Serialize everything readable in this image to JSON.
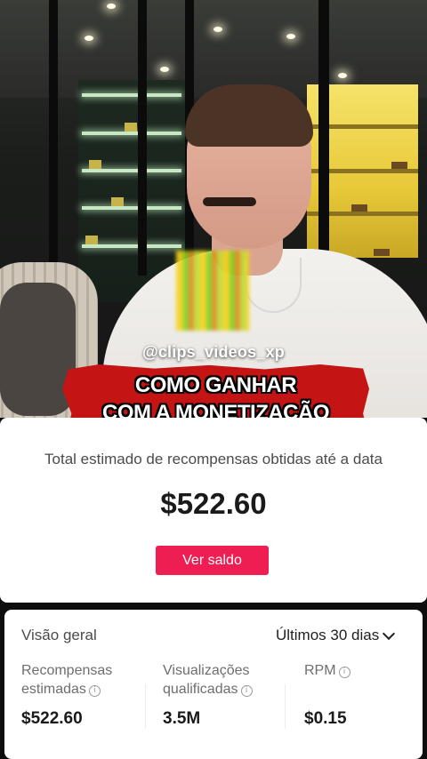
{
  "video": {
    "watermark": "@clips_videos_xp",
    "banner_line1": "COMO GANHAR",
    "banner_line2": "COM A MONETIZAÇÃO"
  },
  "rewards_card": {
    "label": "Total estimado de recompensas obtidas até a data",
    "amount": "$522.60",
    "button": "Ver saldo"
  },
  "overview": {
    "title": "Visão geral",
    "period": "Últimos 30 dias",
    "metrics": [
      {
        "label_line1": "Recompensas",
        "label_line2": "estimadas",
        "value": "$522.60"
      },
      {
        "label_line1": "Visualizações",
        "label_line2": "qualificadas",
        "value": "3.5M"
      },
      {
        "label_line1": "RPM",
        "label_line2": "",
        "value": "$0.15"
      }
    ]
  },
  "colors": {
    "accent": "#ee1d52",
    "banner": "#c41414"
  },
  "icons": [
    "info-icon",
    "chevron-down-icon"
  ]
}
